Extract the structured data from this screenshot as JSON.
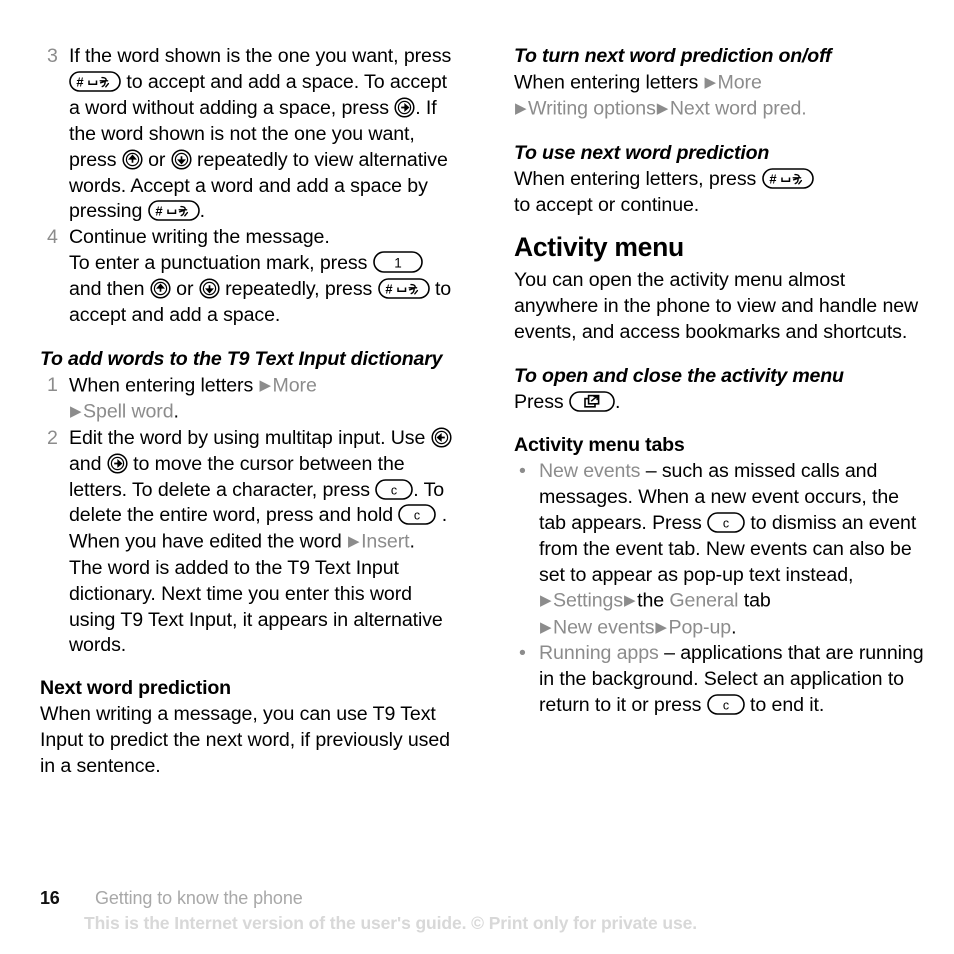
{
  "document": {
    "title": "Getting to know the phone",
    "page_number": "16",
    "watermark": "This is the Internet version of the user's guide. © Print only for private use."
  },
  "icons": {
    "hash_key": "hash-space-key-icon",
    "nav_right_key": "navigation-right-key-icon",
    "nav_up_key": "navigation-up-key-icon",
    "nav_down_key": "navigation-down-key-icon",
    "one_key": "digit-one-key-icon",
    "clear_key": "clear-c-key-icon",
    "activity_key": "activity-menu-key-icon",
    "arrow_marker": "▶",
    "bullet_marker": "•"
  },
  "colors": {
    "text": "#000000",
    "menu_term": "#8c8c8c",
    "list_number": "#8c8c8c",
    "breadcrumb": "#a8a8a8",
    "watermark": "#d8d8d8",
    "background": "#ffffff"
  },
  "left_column": {
    "steps_continued": [
      {
        "number": "3",
        "segments": [
          {
            "t": "text",
            "v": "If the word shown is the one you want, press "
          },
          {
            "t": "key",
            "v": "hash_key"
          },
          {
            "t": "text",
            "v": " to accept and add a space. To accept a word without adding a space, press "
          },
          {
            "t": "key",
            "v": "nav_right_key"
          },
          {
            "t": "text",
            "v": ". If the word shown is not the one you want, press "
          },
          {
            "t": "key",
            "v": "nav_up_key"
          },
          {
            "t": "text",
            "v": " or "
          },
          {
            "t": "key",
            "v": "nav_down_key"
          },
          {
            "t": "text",
            "v": " repeatedly to view alternative words. Accept a word and add a space by pressing "
          },
          {
            "t": "key",
            "v": "hash_key"
          },
          {
            "t": "text",
            "v": "."
          }
        ]
      },
      {
        "number": "4",
        "segments": [
          {
            "t": "text",
            "v": "Continue writing the message."
          },
          {
            "t": "br"
          },
          {
            "t": "text",
            "v": "To enter a punctuation mark, press "
          },
          {
            "t": "key",
            "v": "one_key"
          },
          {
            "t": "text",
            "v": " and then "
          },
          {
            "t": "key",
            "v": "nav_up_key"
          },
          {
            "t": "text",
            "v": " or "
          },
          {
            "t": "key",
            "v": "nav_down_key"
          },
          {
            "t": "text",
            "v": " repeatedly, press "
          },
          {
            "t": "key",
            "v": "hash_key"
          },
          {
            "t": "text",
            "v": " to accept and add a space."
          }
        ]
      }
    ],
    "procedure_heading": "To add words to the T9 Text Input dictionary",
    "procedure_steps": [
      {
        "number": "1",
        "segments": [
          {
            "t": "text",
            "v": "When entering letters "
          },
          {
            "t": "arrow"
          },
          {
            "t": "menu",
            "v": "More"
          },
          {
            "t": "br"
          },
          {
            "t": "arrow"
          },
          {
            "t": "menu",
            "v": "Spell word"
          },
          {
            "t": "text",
            "v": "."
          }
        ]
      },
      {
        "number": "2",
        "segments": [
          {
            "t": "text",
            "v": "Edit the word by using multitap input. Use "
          },
          {
            "t": "key",
            "v": "nav_left_key"
          },
          {
            "t": "text",
            "v": " and "
          },
          {
            "t": "key",
            "v": "nav_right_key"
          },
          {
            "t": "text",
            "v": " to move the cursor between the letters. To delete a character, press "
          },
          {
            "t": "key",
            "v": "clear_key"
          },
          {
            "t": "text",
            "v": ". To delete the entire word, press and hold "
          },
          {
            "t": "key",
            "v": "clear_key"
          },
          {
            "t": "text",
            "v": " ."
          },
          {
            "t": "br"
          },
          {
            "t": "text",
            "v": "When you have edited the word "
          },
          {
            "t": "arrow"
          },
          {
            "t": "menu",
            "v": "Insert"
          },
          {
            "t": "text",
            "v": ". The word is added to the T9 Text Input dictionary. Next time you enter this word using T9 Text Input, it appears in alternative words."
          }
        ]
      }
    ],
    "subsection_heading": "Next word prediction",
    "subsection_body": "When writing a message, you can use T9 Text Input to predict the next word, if previously used in a sentence."
  },
  "right_column": {
    "proc_toggle_heading": "To turn next word prediction on/off",
    "proc_toggle_segments": [
      {
        "t": "text",
        "v": "When entering letters "
      },
      {
        "t": "arrow"
      },
      {
        "t": "menu",
        "v": "More"
      },
      {
        "t": "br"
      },
      {
        "t": "arrow"
      },
      {
        "t": "menu",
        "v": "Writing options"
      },
      {
        "t": "arrow"
      },
      {
        "t": "menu",
        "v": "Next word pred."
      }
    ],
    "proc_use_heading": "To use next word prediction",
    "proc_use_segments": [
      {
        "t": "text",
        "v": "When entering letters, press "
      },
      {
        "t": "key",
        "v": "hash_key"
      },
      {
        "t": "br"
      },
      {
        "t": "text",
        "v": "to accept or continue."
      }
    ],
    "section_heading": "Activity menu",
    "section_body": "You can open the activity menu almost anywhere in the phone to view and handle new events, and access bookmarks and shortcuts.",
    "proc_open_heading": "To open and close the activity menu",
    "proc_open_segments": [
      {
        "t": "text",
        "v": "Press "
      },
      {
        "t": "key",
        "v": "activity_key"
      },
      {
        "t": "text",
        "v": "."
      }
    ],
    "tabs_heading": "Activity menu tabs",
    "tabs": [
      {
        "segments": [
          {
            "t": "menu",
            "v": "New events"
          },
          {
            "t": "text",
            "v": " – such as missed calls and messages. When a new event occurs, the tab appears. Press "
          },
          {
            "t": "key",
            "v": "clear_key"
          },
          {
            "t": "text",
            "v": " to dismiss an event from the event tab. New events can also be set to appear as pop-up text instead,"
          },
          {
            "t": "br"
          },
          {
            "t": "arrow"
          },
          {
            "t": "menu",
            "v": "Settings"
          },
          {
            "t": "arrow"
          },
          {
            "t": "text",
            "v": "the "
          },
          {
            "t": "menu",
            "v": "General"
          },
          {
            "t": "text",
            "v": " tab"
          },
          {
            "t": "br"
          },
          {
            "t": "arrow"
          },
          {
            "t": "menu",
            "v": "New events"
          },
          {
            "t": "arrow"
          },
          {
            "t": "menu",
            "v": "Pop-up"
          },
          {
            "t": "text",
            "v": "."
          }
        ]
      },
      {
        "segments": [
          {
            "t": "menu",
            "v": "Running apps"
          },
          {
            "t": "text",
            "v": " – applications that are running in the background. Select an application to return to it or press "
          },
          {
            "t": "key",
            "v": "clear_key"
          },
          {
            "t": "text",
            "v": " to end it."
          }
        ]
      }
    ]
  }
}
